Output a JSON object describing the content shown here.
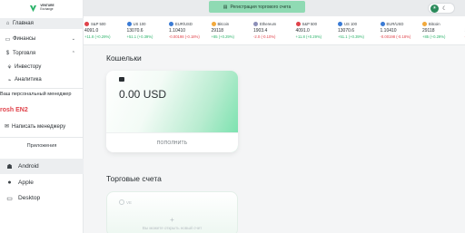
{
  "brand": {
    "line1": "VENTURE",
    "line2": "Exchange"
  },
  "topbar": {
    "promo_label": "Регистрация торгового счета"
  },
  "sidebar": {
    "items": [
      {
        "label": "Главная",
        "icon": "home-icon"
      },
      {
        "label": "Финансы",
        "icon": "wallet-icon"
      },
      {
        "label": "Торговля",
        "icon": "dollar-icon"
      },
      {
        "label": "Инвестору",
        "icon": "invest-icon"
      },
      {
        "label": "Аналитика",
        "icon": "chart-icon"
      }
    ],
    "manager_title": "Ваш персональный менеджер",
    "manager_name": "rosh EN2",
    "write_manager": "Написать менеджеру",
    "apps_title": "Приложения",
    "apps": [
      {
        "label": "Android",
        "icon": "android-icon"
      },
      {
        "label": "Apple",
        "icon": "apple-icon"
      },
      {
        "label": "Desktop",
        "icon": "desktop-icon"
      }
    ]
  },
  "ticker": [
    {
      "name": "S&P 500",
      "price": "4091.0",
      "change": "+11.8 (+0.29%)",
      "dir": "up",
      "color": "#e0424a"
    },
    {
      "name": "US 100",
      "price": "13070.6",
      "change": "+51.1 (+0.39%)",
      "dir": "up",
      "color": "#3a7bd5"
    },
    {
      "name": "EUR/USD",
      "price": "1.10410",
      "change": "-0.00198 (-0.18%)",
      "dir": "down",
      "color": "#3a7bd5"
    },
    {
      "name": "Bitcoin",
      "price": "29118",
      "change": "+85 (+0.29%)",
      "dir": "up",
      "color": "#f2a93b"
    },
    {
      "name": "Ethereum",
      "price": "1903.4",
      "change": "-2.0 (-0.10%)",
      "dir": "down",
      "color": "#8c8fb8"
    },
    {
      "name": "S&P 500",
      "price": "4091.0",
      "change": "+11.8 (+0.29%)",
      "dir": "up",
      "color": "#e0424a"
    },
    {
      "name": "US 100",
      "price": "13070.6",
      "change": "+51.1 (+0.39%)",
      "dir": "up",
      "color": "#3a7bd5"
    },
    {
      "name": "EUR/USD",
      "price": "1.10410",
      "change": "-0.00198 (-0.18%)",
      "dir": "down",
      "color": "#3a7bd5"
    },
    {
      "name": "Bitcoin",
      "price": "29118",
      "change": "+85 (+0.29%)",
      "dir": "up",
      "color": "#f2a93b"
    },
    {
      "name": "E",
      "price": "1",
      "change": "-",
      "dir": "down",
      "color": "#8c8fb8"
    }
  ],
  "main": {
    "wallets_title": "Кошельки",
    "wallet_amount": "0.00 USD",
    "wallet_topup": "ПОПОЛНИТЬ",
    "accounts_title": "Торговые счета",
    "account_logo_text": "VE",
    "account_plus": "+",
    "account_hint": "Вы можете открыть новый счет"
  },
  "colors": {
    "accent": "#2bb36a",
    "promo": "#8fdab3",
    "danger": "#e0424a"
  }
}
